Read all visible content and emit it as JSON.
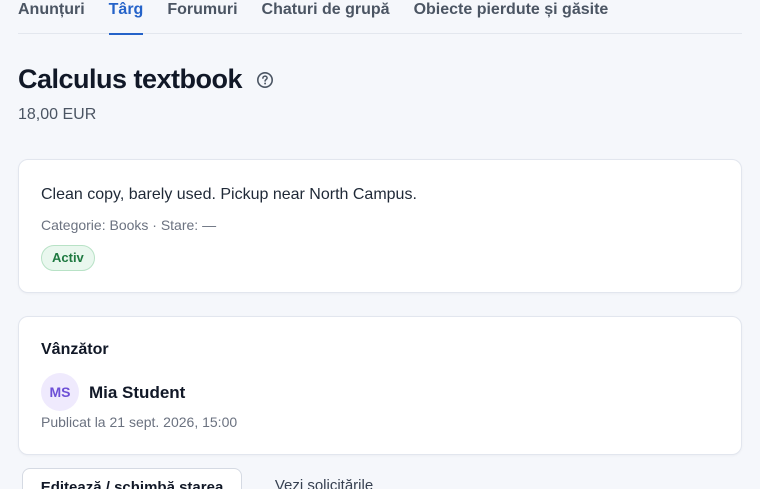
{
  "nav": {
    "tabs": [
      {
        "label": "Anunțuri"
      },
      {
        "label": "Târg",
        "active": true
      },
      {
        "label": "Forumuri"
      },
      {
        "label": "Chaturi de grupă"
      },
      {
        "label": "Obiecte pierdute și găsite"
      }
    ]
  },
  "listing": {
    "title": "Calculus textbook",
    "help_icon": "question-circle-icon",
    "price": "18,00 EUR",
    "description": "Clean copy, barely used. Pickup near North Campus.",
    "meta": "Categorie: Books · Stare: —",
    "status": "Activ"
  },
  "seller": {
    "heading": "Vânzător",
    "initials": "MS",
    "name": "Mia Student",
    "published": "Publicat la 21 sept. 2026, 15:00"
  },
  "actions": {
    "edit_label": "Editează / schimbă starea",
    "requests_label": "Vezi solicitările"
  },
  "colors": {
    "accent": "#2563c9",
    "status_bg": "#e9f7ee",
    "status_text": "#1f7a41",
    "avatar_bg": "#efeafd",
    "avatar_text": "#6d4fd6"
  }
}
